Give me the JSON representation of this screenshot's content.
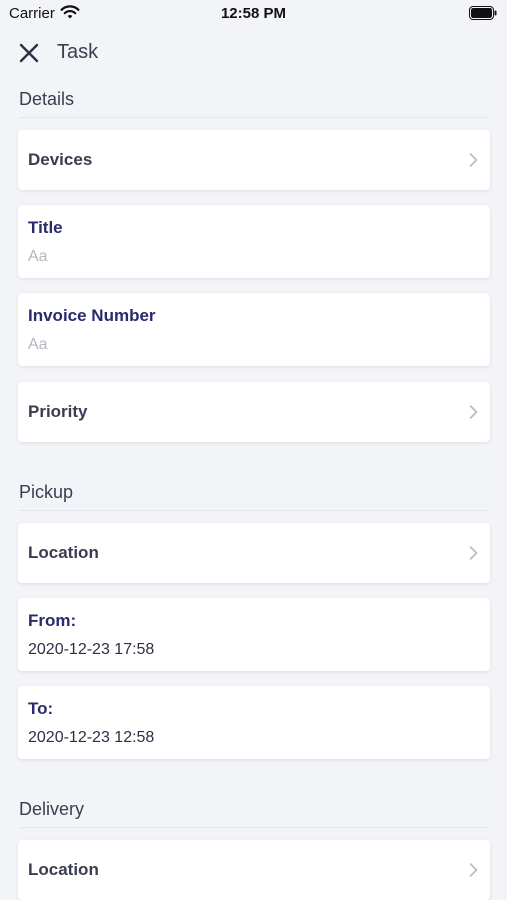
{
  "status_bar": {
    "carrier": "Carrier",
    "time": "12:58 PM"
  },
  "nav": {
    "title": "Task"
  },
  "sections": {
    "details": {
      "header": "Details",
      "devices_label": "Devices",
      "title_label": "Title",
      "title_placeholder": "Aa",
      "invoice_label": "Invoice Number",
      "invoice_placeholder": "Aa",
      "priority_label": "Priority"
    },
    "pickup": {
      "header": "Pickup",
      "location_label": "Location",
      "from_label": "From:",
      "from_value": "2020-12-23 17:58",
      "to_label": "To:",
      "to_value": "2020-12-23 12:58"
    },
    "delivery": {
      "header": "Delivery",
      "location_label": "Location"
    }
  },
  "icons": {
    "close": "close-icon",
    "chevron": "chevron-right-icon",
    "wifi": "wifi-icon",
    "battery": "battery-icon"
  },
  "colors": {
    "background": "#f3f4f8",
    "card": "#ffffff",
    "field_label": "#2b2a6b",
    "placeholder": "#b6b7bf"
  }
}
